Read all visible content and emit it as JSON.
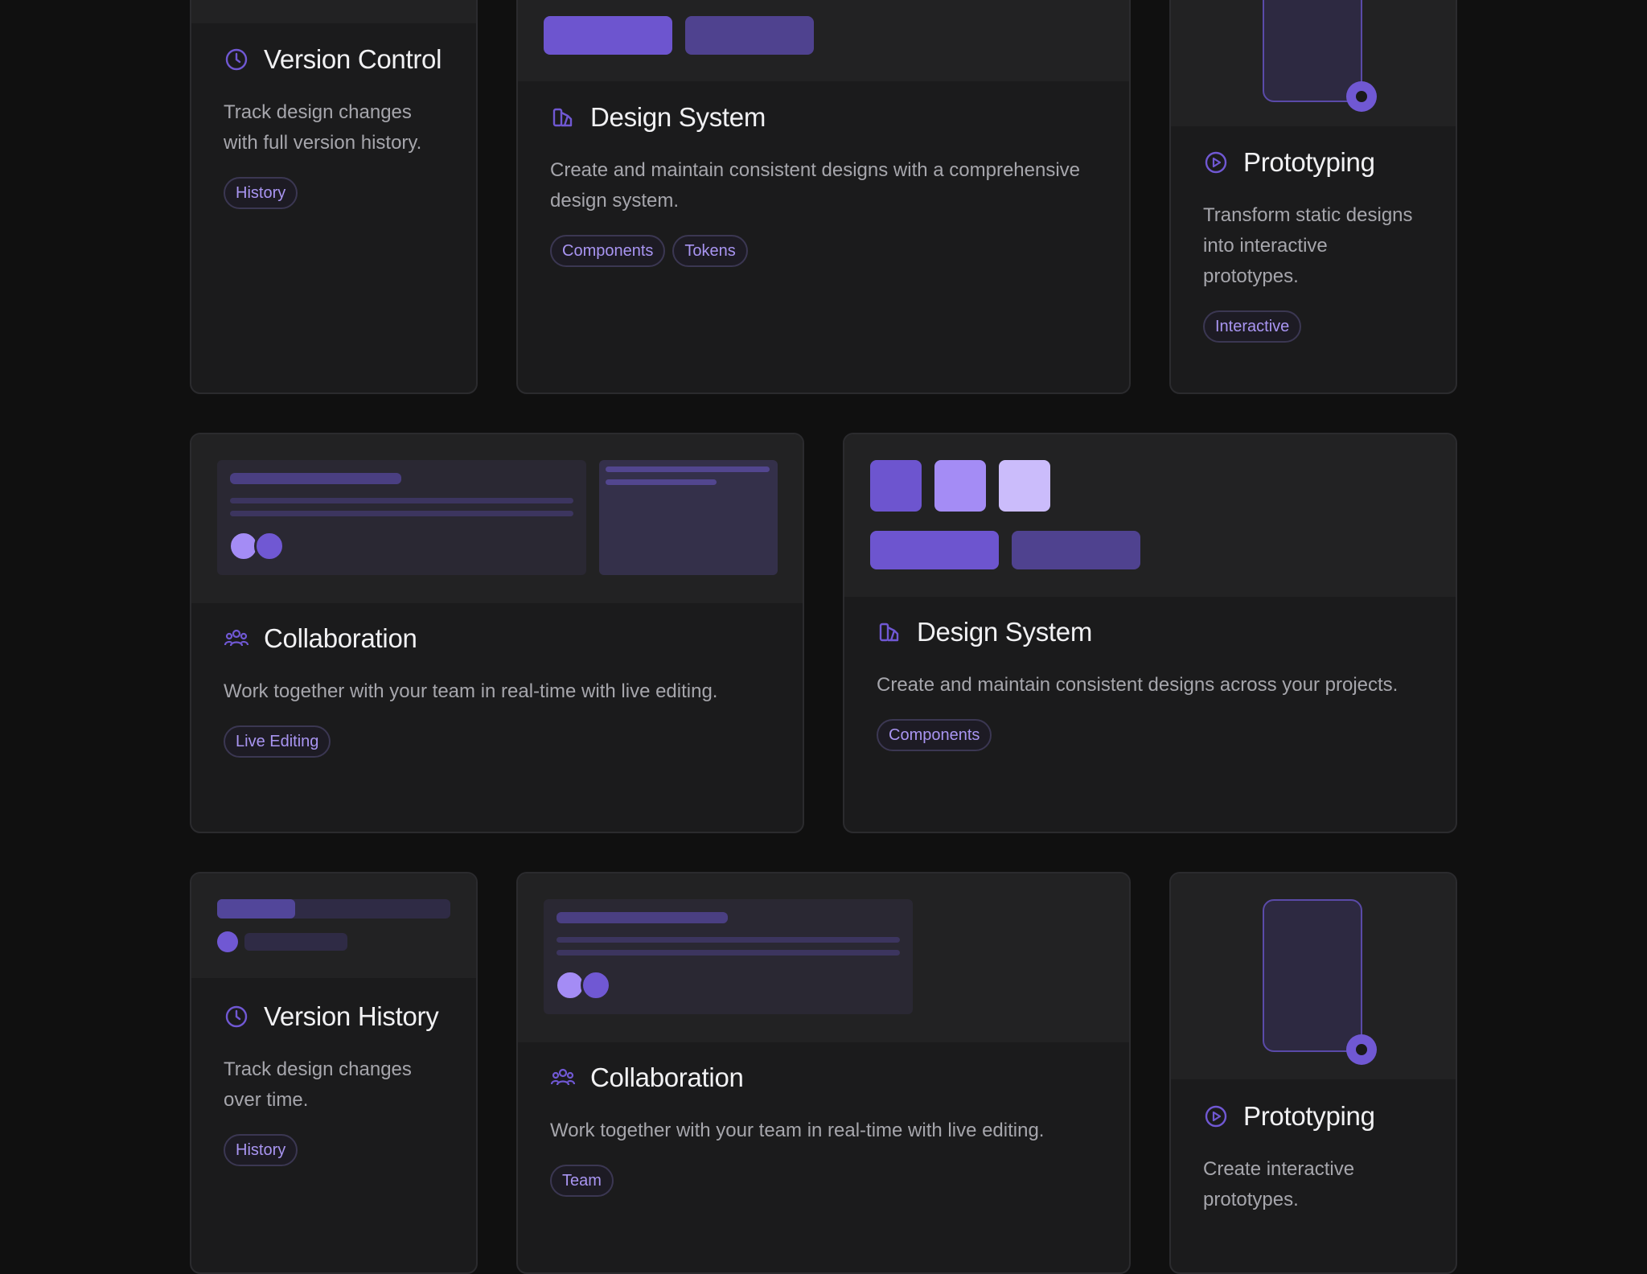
{
  "colors": {
    "background": "#101010",
    "card": "#1b1b1c",
    "accent": "#7058d3",
    "accent_light": "#a995f2",
    "text": "#f1f1f3",
    "muted_text": "#a6a6ac"
  },
  "cards": [
    {
      "icon": "clock-icon",
      "title": "Version Control",
      "description": "Track design changes with full version history.",
      "tags": [
        "History"
      ]
    },
    {
      "icon": "palette-icon",
      "title": "Design System",
      "description": "Create and maintain consistent designs with a comprehensive design system.",
      "tags": [
        "Components",
        "Tokens"
      ]
    },
    {
      "icon": "play-circle-icon",
      "title": "Prototyping",
      "description": "Transform static designs into interactive prototypes.",
      "tags": [
        "Interactive"
      ]
    },
    {
      "icon": "users-icon",
      "title": "Collaboration",
      "description": "Work together with your team in real-time with live editing.",
      "tags": [
        "Live Editing"
      ]
    },
    {
      "icon": "palette-icon",
      "title": "Design System",
      "description": "Create and maintain consistent designs across your projects.",
      "tags": [
        "Components"
      ]
    },
    {
      "icon": "clock-icon",
      "title": "Version History",
      "description": "Track design changes over time.",
      "tags": [
        "History"
      ]
    },
    {
      "icon": "users-icon",
      "title": "Collaboration",
      "description": "Work together with your team in real-time with live editing.",
      "tags": [
        "Team"
      ]
    },
    {
      "icon": "play-circle-icon",
      "title": "Prototyping",
      "description": "Create interactive prototypes.",
      "tags": []
    }
  ]
}
